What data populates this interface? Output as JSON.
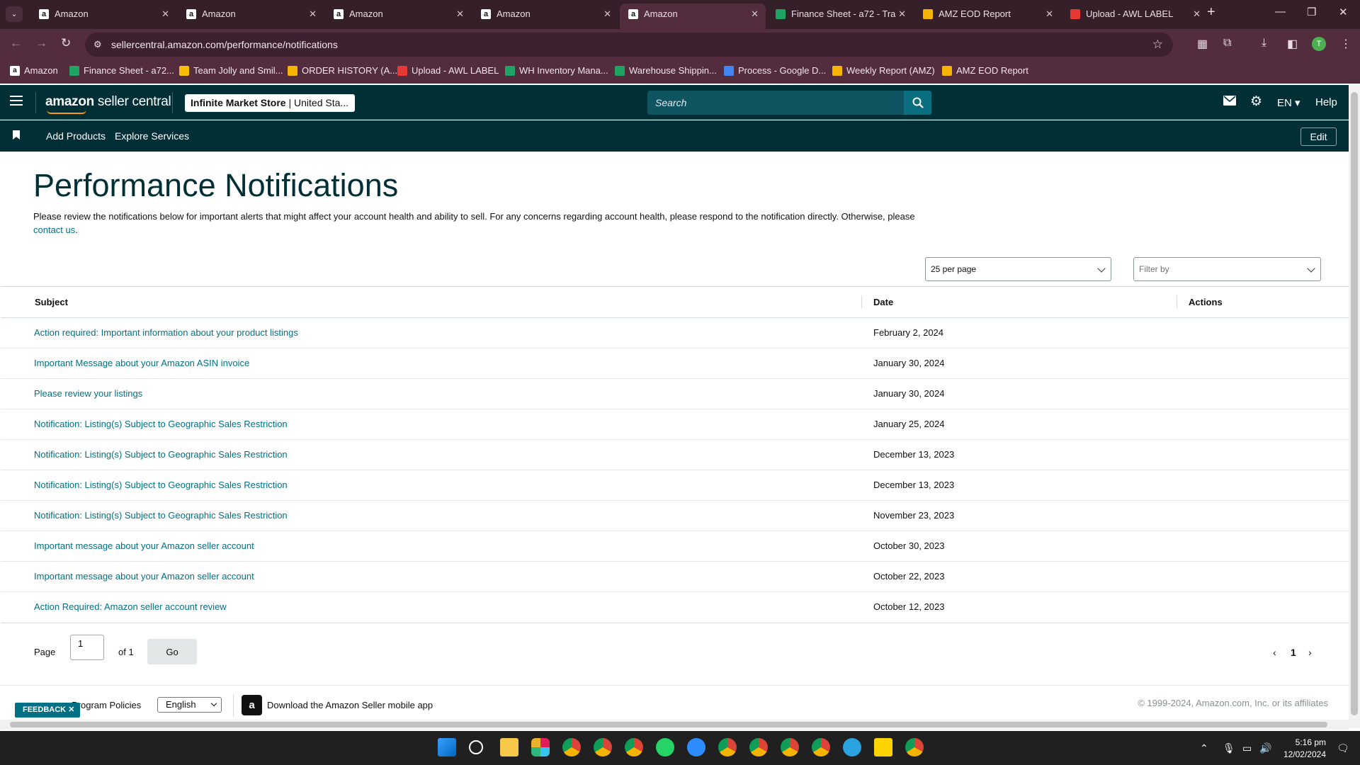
{
  "browser": {
    "tabs": [
      {
        "title": "Amazon",
        "favicon": "amazon-icon",
        "active": false
      },
      {
        "title": "Amazon",
        "favicon": "amazon-icon",
        "active": false
      },
      {
        "title": "Amazon",
        "favicon": "amazon-icon",
        "active": false
      },
      {
        "title": "Amazon",
        "favicon": "amazon-icon",
        "active": false
      },
      {
        "title": "Amazon",
        "favicon": "amazon-icon",
        "active": true
      },
      {
        "title": "Finance Sheet - a72 - Tra",
        "favicon": "sheets-icon",
        "active": false
      },
      {
        "title": "AMZ EOD Report",
        "favicon": "report-icon",
        "active": false
      },
      {
        "title": "Upload - AWL LABEL",
        "favicon": "upload-icon",
        "active": false
      }
    ],
    "url": "sellercentral.amazon.com/performance/notifications",
    "profile_initial": "T",
    "bookmarks": [
      {
        "label": "Amazon",
        "icon": "amazon-icon"
      },
      {
        "label": "Finance Sheet - a72...",
        "icon": "sheets-icon"
      },
      {
        "label": "Team Jolly and Smil...",
        "icon": "drive-icon"
      },
      {
        "label": "ORDER HISTORY (A...",
        "icon": "report-icon"
      },
      {
        "label": "Upload - AWL LABEL",
        "icon": "upload-icon"
      },
      {
        "label": "WH Inventory Mana...",
        "icon": "sheets-icon"
      },
      {
        "label": "Warehouse Shippin...",
        "icon": "sheets-icon"
      },
      {
        "label": "Process - Google D...",
        "icon": "docs-icon"
      },
      {
        "label": "Weekly Report (AMZ)",
        "icon": "report-icon"
      },
      {
        "label": "AMZ EOD Report",
        "icon": "report-icon"
      }
    ]
  },
  "header": {
    "logo_bold": "amazon",
    "logo_rest": " seller central",
    "store_name": "Infinite Market Store",
    "store_region": " | United Sta...",
    "search_placeholder": "Search",
    "language": "EN",
    "help": "Help"
  },
  "subnav": {
    "links": [
      "Add Products",
      "Explore Services"
    ],
    "edit": "Edit"
  },
  "main": {
    "title": "Performance Notifications",
    "intro": "Please review the notifications below for important alerts that might affect your account health and ability to sell. For any concerns regarding account health, please respond to the notification directly. Otherwise, please ",
    "contact_link": "contact us",
    "intro_end": ".",
    "per_page": "25 per page",
    "filter_placeholder": "Filter by",
    "columns": {
      "subject": "Subject",
      "date": "Date",
      "actions": "Actions"
    },
    "rows": [
      {
        "subject": "Action required: Important information about your product listings",
        "date": "February 2, 2024"
      },
      {
        "subject": "Important Message about your Amazon ASIN invoice",
        "date": "January 30, 2024"
      },
      {
        "subject": "Please review your listings",
        "date": "January 30, 2024"
      },
      {
        "subject": "Notification: Listing(s) Subject to Geographic Sales Restriction",
        "date": "January 25, 2024"
      },
      {
        "subject": "Notification: Listing(s) Subject to Geographic Sales Restriction",
        "date": "December 13, 2023"
      },
      {
        "subject": "Notification: Listing(s) Subject to Geographic Sales Restriction",
        "date": "December 13, 2023"
      },
      {
        "subject": "Notification: Listing(s) Subject to Geographic Sales Restriction",
        "date": "November 23, 2023"
      },
      {
        "subject": "Important message about your Amazon seller account",
        "date": "October 30, 2023"
      },
      {
        "subject": "Important message about your Amazon seller account",
        "date": "October 22, 2023"
      },
      {
        "subject": "Action Required: Amazon seller account review",
        "date": "October 12, 2023"
      }
    ],
    "pager": {
      "page_label": "Page",
      "page_value": "1",
      "of_label": "of 1",
      "go": "Go",
      "current": "1"
    }
  },
  "footer": {
    "program_policies": "Program Policies",
    "language": "English",
    "download_app": "Download the Amazon Seller mobile app",
    "copyright": "© 1999-2024, Amazon.com, Inc. or its affiliates",
    "feedback": "FEEDBACK"
  },
  "taskbar": {
    "time": "5:16 pm",
    "date": "12/02/2024",
    "apps": [
      "windows-start-icon",
      "search-icon",
      "file-explorer-icon",
      "slack-icon",
      "chrome-icon",
      "chrome-icon",
      "chrome-icon",
      "whatsapp-icon",
      "zoom-icon",
      "chrome-icon",
      "chrome-icon",
      "chrome-icon",
      "chrome-icon",
      "telegram-icon",
      "sticky-notes-icon",
      "chrome-icon"
    ]
  },
  "colors": {
    "sc_header": "#002f36",
    "link": "#007185",
    "browser_frame": "#532d3e"
  }
}
